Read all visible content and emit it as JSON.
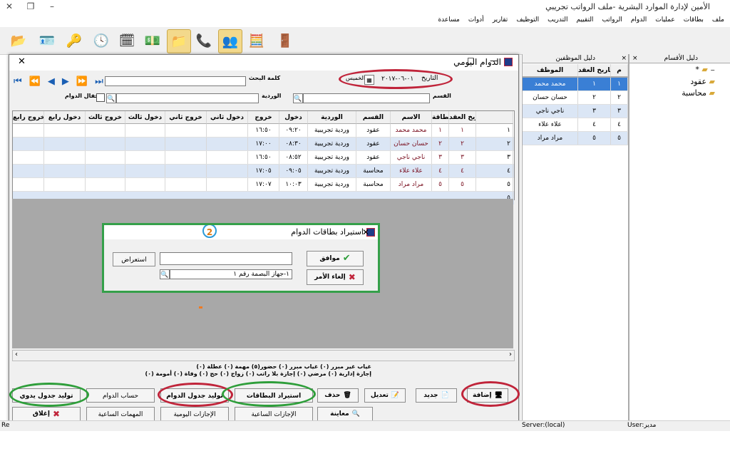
{
  "app": {
    "title": "الأمين لإدارة الموارد البشرية -ملف الرواتب تجريبي",
    "win_minimize": "–",
    "win_restore": "❐",
    "win_close": "✕"
  },
  "menu": [
    "ملف",
    "بطاقات",
    "عمليات",
    "الدوام",
    "الرواتب",
    "التقييم",
    "التدريب",
    "التوظيف",
    "تقارير",
    "أدوات",
    "مساعدة"
  ],
  "toolbar": [
    "exit-icon",
    "employee-card-icon",
    "key-icon",
    "clock-icon",
    "calendar-icon",
    "money-icon",
    "folder-icon",
    "phone-folder-icon",
    "users-folder-icon",
    "calculator-icon",
    "door-exit-icon"
  ],
  "departments_panel": {
    "title": "دليل الأقسام",
    "close": "×",
    "tree": [
      "*",
      "عقود",
      "محاسبة"
    ]
  },
  "employees_panel": {
    "title": "دليل الموظفين",
    "close": "×",
    "headers": [
      "م",
      "تاريخ العقد",
      "الموظف"
    ],
    "rows": [
      {
        "n": "١",
        "date": "١",
        "name": "محمد محمد"
      },
      {
        "n": "٢",
        "date": "٢",
        "name": "حسان حسان"
      },
      {
        "n": "٣",
        "date": "٣",
        "name": "ناجي ناجي"
      },
      {
        "n": "٤",
        "date": "٤",
        "name": "علاء علاء"
      },
      {
        "n": "٥",
        "date": "٥",
        "name": "مراد مراد"
      }
    ]
  },
  "daily_window": {
    "title": "الدوام اليومي",
    "min": "—",
    "max": "☐",
    "close": "✕",
    "date_label": "التاريخ",
    "date_value": "٠١-٠٦-٢٠١٧",
    "day_name": "الخميس",
    "search_label": "كلمة البحث",
    "close_day_label": "إقفال الدوام",
    "shift_label": "الوردية",
    "dept_label": "القسم",
    "headers": [
      "تاريخ العقد",
      "رقم البطاقة",
      "الاسم",
      "القسم",
      "الوردية",
      "دخول",
      "خروج",
      "دخول ثاني",
      "خروج ثاني",
      "دخول ثالث",
      "خروج ثالث",
      "دخول رابع",
      "خروج رابع"
    ],
    "rows": [
      {
        "idx": "١",
        "date": "١",
        "card": "١",
        "name": "محمد محمد",
        "dept": "عقود",
        "shift": "وردية تجريبية",
        "in": "٠٩:٢٠",
        "out": "١٦:٥٠"
      },
      {
        "idx": "٢",
        "date": "٢",
        "card": "٢",
        "name": "حسان حسان",
        "dept": "عقود",
        "shift": "وردية تجريبية",
        "in": "٠٨:٣٠",
        "out": "١٧:٠٠"
      },
      {
        "idx": "٣",
        "date": "٣",
        "card": "٣",
        "name": "ناجي ناجي",
        "dept": "عقود",
        "shift": "وردية تجريبية",
        "in": "٠٨:٥٢",
        "out": "١٦:٥٠"
      },
      {
        "idx": "٤",
        "date": "٤",
        "card": "٤",
        "name": "علاء علاء",
        "dept": "محاسبة",
        "shift": "وردية تجريبية",
        "in": "٠٩:٠٥",
        "out": "١٧:٠٥"
      },
      {
        "idx": "٥",
        "date": "٥",
        "card": "٥",
        "name": "مراد مراد",
        "dept": "محاسبة",
        "shift": "وردية تجريبية",
        "in": "١٠:٠٣",
        "out": "١٧:٠٧"
      }
    ],
    "new_row_idx": "٥",
    "summary_line1": "غياب غير مبرر (٠)  غياب مبرر (٠)  حضور(٥)  مهمة (٠)  عطلة (٠)",
    "summary_line2": "إجازة إدارية (٠)  مرضي (٠)  إجازة بلا راتب (٠)  زواج (٠)  حج (٠)  وفاة (٠)  أمومة (٠)",
    "buttons": {
      "add": "إضافة",
      "new": "جديد",
      "edit": "تعديل",
      "delete": "حذف",
      "import_cards": "استيراد البطاقات",
      "generate_table": "توليد جدول الدوام",
      "calc_shift": "حساب الدوام",
      "manual_table": "توليد جدول يدوي",
      "preview": "معاينة",
      "hourly_leave": "الإجازات الساعية",
      "daily_leave": "الإجازات اليومية",
      "hourly_tasks": "المهمات الساعية",
      "close": "إغلاق"
    }
  },
  "import_dialog": {
    "title": "استيراد بطاقات الدوام",
    "step": "2",
    "close": "✕",
    "path_value": "",
    "browse": "استعراض",
    "device_value": "١-جهاز البصمة رقم ١",
    "ok": "موافق",
    "cancel": "إلغاء الأمر"
  },
  "status": {
    "left": "Re",
    "server": "Server:(local)",
    "user": "User:مدير"
  },
  "colors": {
    "highlight_red": "#c0243a",
    "highlight_green": "#2e9e3a",
    "row_alt": "#dbe6f5",
    "selected_blue": "#3a7fd5"
  }
}
